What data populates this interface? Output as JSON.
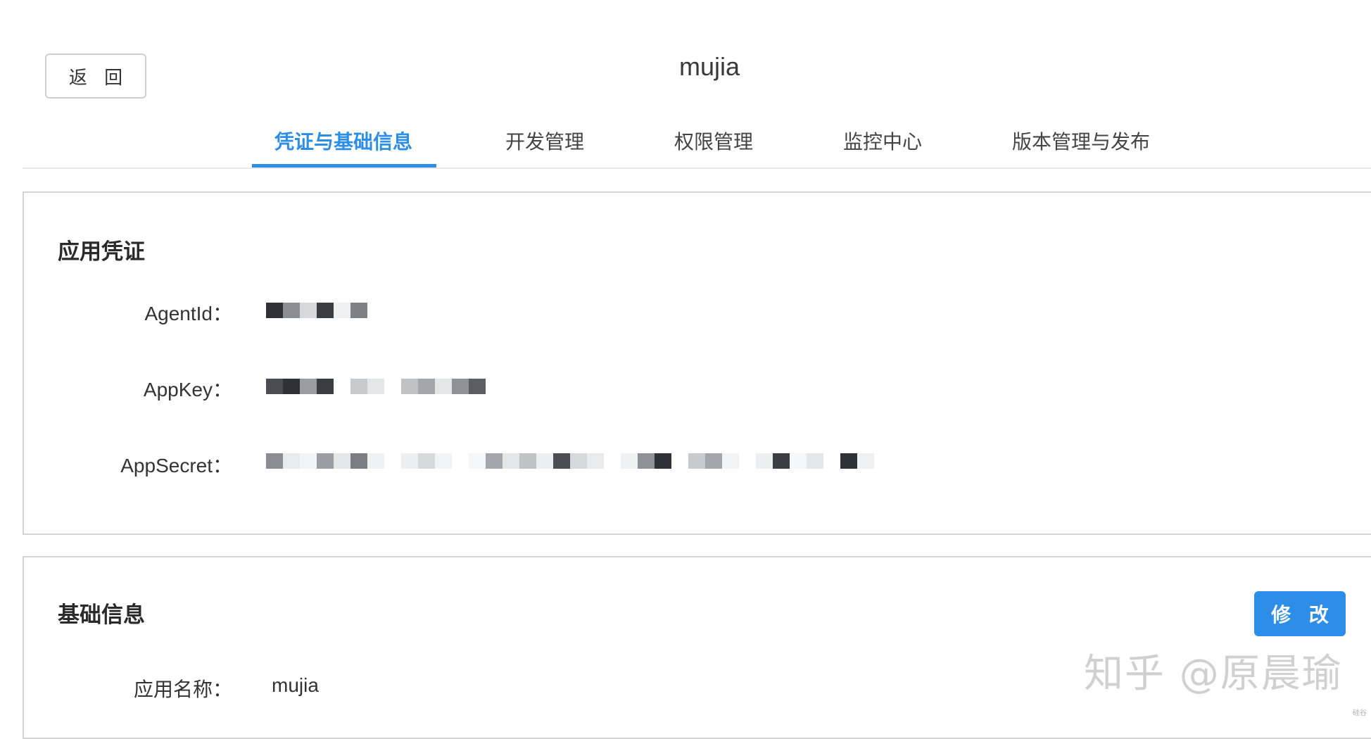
{
  "header": {
    "back_label": "返 回",
    "app_name": "mujia"
  },
  "tabs": [
    {
      "label": "凭证与基础信息",
      "active": true
    },
    {
      "label": "开发管理",
      "active": false
    },
    {
      "label": "权限管理",
      "active": false
    },
    {
      "label": "监控中心",
      "active": false
    },
    {
      "label": "版本管理与发布",
      "active": false
    }
  ],
  "credentials": {
    "title": "应用凭证",
    "fields": [
      {
        "label": "AgentId：",
        "value_redacted": true
      },
      {
        "label": "AppKey：",
        "value_redacted": true
      },
      {
        "label": "AppSecret：",
        "value_redacted": true
      }
    ]
  },
  "basic_info": {
    "title": "基础信息",
    "edit_label": "修 改",
    "fields": [
      {
        "label": "应用名称：",
        "value": "mujia"
      }
    ]
  },
  "watermark": {
    "text": "知乎 @原晨瑜",
    "small": "硅谷"
  },
  "colors": {
    "accent": "#2d8ee8",
    "border": "#d4d4d4",
    "text": "#333333"
  }
}
